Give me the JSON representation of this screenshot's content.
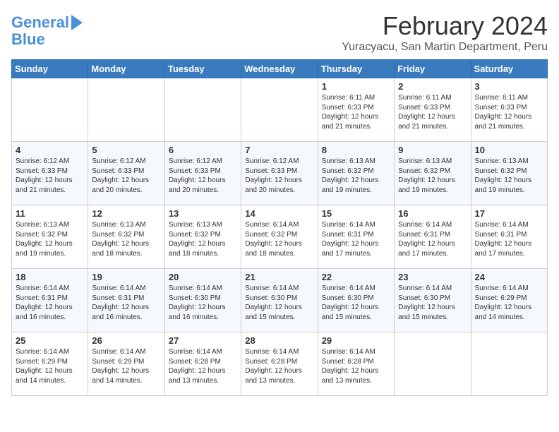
{
  "logo": {
    "line1": "General",
    "line2": "Blue"
  },
  "title": "February 2024",
  "location": "Yuracyacu, San Martin Department, Peru",
  "days_of_week": [
    "Sunday",
    "Monday",
    "Tuesday",
    "Wednesday",
    "Thursday",
    "Friday",
    "Saturday"
  ],
  "weeks": [
    [
      {
        "day": "",
        "info": ""
      },
      {
        "day": "",
        "info": ""
      },
      {
        "day": "",
        "info": ""
      },
      {
        "day": "",
        "info": ""
      },
      {
        "day": "1",
        "info": "Sunrise: 6:11 AM\nSunset: 6:33 PM\nDaylight: 12 hours\nand 21 minutes."
      },
      {
        "day": "2",
        "info": "Sunrise: 6:11 AM\nSunset: 6:33 PM\nDaylight: 12 hours\nand 21 minutes."
      },
      {
        "day": "3",
        "info": "Sunrise: 6:11 AM\nSunset: 6:33 PM\nDaylight: 12 hours\nand 21 minutes."
      }
    ],
    [
      {
        "day": "4",
        "info": "Sunrise: 6:12 AM\nSunset: 6:33 PM\nDaylight: 12 hours\nand 21 minutes."
      },
      {
        "day": "5",
        "info": "Sunrise: 6:12 AM\nSunset: 6:33 PM\nDaylight: 12 hours\nand 20 minutes."
      },
      {
        "day": "6",
        "info": "Sunrise: 6:12 AM\nSunset: 6:33 PM\nDaylight: 12 hours\nand 20 minutes."
      },
      {
        "day": "7",
        "info": "Sunrise: 6:12 AM\nSunset: 6:33 PM\nDaylight: 12 hours\nand 20 minutes."
      },
      {
        "day": "8",
        "info": "Sunrise: 6:13 AM\nSunset: 6:32 PM\nDaylight: 12 hours\nand 19 minutes."
      },
      {
        "day": "9",
        "info": "Sunrise: 6:13 AM\nSunset: 6:32 PM\nDaylight: 12 hours\nand 19 minutes."
      },
      {
        "day": "10",
        "info": "Sunrise: 6:13 AM\nSunset: 6:32 PM\nDaylight: 12 hours\nand 19 minutes."
      }
    ],
    [
      {
        "day": "11",
        "info": "Sunrise: 6:13 AM\nSunset: 6:32 PM\nDaylight: 12 hours\nand 19 minutes."
      },
      {
        "day": "12",
        "info": "Sunrise: 6:13 AM\nSunset: 6:32 PM\nDaylight: 12 hours\nand 18 minutes."
      },
      {
        "day": "13",
        "info": "Sunrise: 6:13 AM\nSunset: 6:32 PM\nDaylight: 12 hours\nand 18 minutes."
      },
      {
        "day": "14",
        "info": "Sunrise: 6:14 AM\nSunset: 6:32 PM\nDaylight: 12 hours\nand 18 minutes."
      },
      {
        "day": "15",
        "info": "Sunrise: 6:14 AM\nSunset: 6:31 PM\nDaylight: 12 hours\nand 17 minutes."
      },
      {
        "day": "16",
        "info": "Sunrise: 6:14 AM\nSunset: 6:31 PM\nDaylight: 12 hours\nand 17 minutes."
      },
      {
        "day": "17",
        "info": "Sunrise: 6:14 AM\nSunset: 6:31 PM\nDaylight: 12 hours\nand 17 minutes."
      }
    ],
    [
      {
        "day": "18",
        "info": "Sunrise: 6:14 AM\nSunset: 6:31 PM\nDaylight: 12 hours\nand 16 minutes."
      },
      {
        "day": "19",
        "info": "Sunrise: 6:14 AM\nSunset: 6:31 PM\nDaylight: 12 hours\nand 16 minutes."
      },
      {
        "day": "20",
        "info": "Sunrise: 6:14 AM\nSunset: 6:30 PM\nDaylight: 12 hours\nand 16 minutes."
      },
      {
        "day": "21",
        "info": "Sunrise: 6:14 AM\nSunset: 6:30 PM\nDaylight: 12 hours\nand 15 minutes."
      },
      {
        "day": "22",
        "info": "Sunrise: 6:14 AM\nSunset: 6:30 PM\nDaylight: 12 hours\nand 15 minutes."
      },
      {
        "day": "23",
        "info": "Sunrise: 6:14 AM\nSunset: 6:30 PM\nDaylight: 12 hours\nand 15 minutes."
      },
      {
        "day": "24",
        "info": "Sunrise: 6:14 AM\nSunset: 6:29 PM\nDaylight: 12 hours\nand 14 minutes."
      }
    ],
    [
      {
        "day": "25",
        "info": "Sunrise: 6:14 AM\nSunset: 6:29 PM\nDaylight: 12 hours\nand 14 minutes."
      },
      {
        "day": "26",
        "info": "Sunrise: 6:14 AM\nSunset: 6:29 PM\nDaylight: 12 hours\nand 14 minutes."
      },
      {
        "day": "27",
        "info": "Sunrise: 6:14 AM\nSunset: 6:28 PM\nDaylight: 12 hours\nand 13 minutes."
      },
      {
        "day": "28",
        "info": "Sunrise: 6:14 AM\nSunset: 6:28 PM\nDaylight: 12 hours\nand 13 minutes."
      },
      {
        "day": "29",
        "info": "Sunrise: 6:14 AM\nSunset: 6:28 PM\nDaylight: 12 hours\nand 13 minutes."
      },
      {
        "day": "",
        "info": ""
      },
      {
        "day": "",
        "info": ""
      }
    ]
  ]
}
